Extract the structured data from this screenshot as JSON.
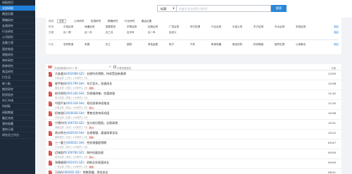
{
  "sidebar": {
    "items": [
      {
        "label": "研报首页"
      },
      {
        "label": "全部研报",
        "active": true
      },
      {
        "label": "晨会纪要"
      },
      {
        "label": "策略研究"
      },
      {
        "label": "宏观研究"
      },
      {
        "label": "行业研究"
      },
      {
        "label": "公司研究"
      },
      {
        "label": "金融工程"
      },
      {
        "label": "固定收益"
      },
      {
        "label": "港股研究"
      },
      {
        "label": "海外研究"
      },
      {
        "label": "债券研究"
      },
      {
        "label": "商品研究"
      },
      {
        "label": "衍生品"
      },
      {
        "label": "新三板"
      },
      {
        "label": "期货研究"
      },
      {
        "label": "投资组合"
      },
      {
        "label": "外汇市场"
      },
      {
        "label": "科创板"
      },
      {
        "label": "研报数据"
      },
      {
        "label": "最近浏览"
      },
      {
        "label": "我的收藏"
      },
      {
        "label": "我的订阅"
      },
      {
        "label": "研究员工作台"
      }
    ]
  },
  "search": {
    "type_label": "标题",
    "placeholder": "关键字/全文检索/分析师",
    "button_label": "搜索"
  },
  "filter": {
    "row1": {
      "label": "类别",
      "tags": [
        "全部",
        "公司研究",
        "宏观研究",
        "策略研究",
        "行业研究",
        "晨会纪要"
      ]
    },
    "row2": {
      "label": "机构",
      "tags": [
        "中信证券",
        "海通证券",
        "国泰君安",
        "华泰证券",
        "招商证券",
        "广发证券",
        "申万宏源",
        "兴业证券",
        "中金公司",
        "东方证券",
        "光大证券",
        "安信证券"
      ]
    },
    "row3": {
      "label": "日期",
      "tags": [
        "近一周",
        "近一月",
        "近三月",
        "近半年",
        "近一年",
        "自定义"
      ]
    },
    "row4": {
      "label": "行业",
      "tags": [
        "农林牧渔",
        "采掘",
        "化工",
        "钢铁",
        "有色金属",
        "电子",
        "汽车",
        "家用电器",
        "食品饮料",
        "纺织服装",
        "医药生物",
        "公用事业"
      ]
    },
    "toggle_label": "收起"
  },
  "list": {
    "header_text": "共找到研报5000+ 条",
    "header_check_label": "只看深度报告",
    "header_date_label": "日期",
    "rows": [
      {
        "company": "大族激光",
        "code": "(002008.SZ)",
        "title": "：业绩符合预期，持续受益新基建",
        "sub": "中泰证券  |  王芳  |  公司研究  |  3页",
        "tag": "",
        "time": "13:55"
      },
      {
        "company": "星宇股份",
        "code": "(601799.SH)",
        "title": "：车灯龙头，加速成长",
        "sub": "国金证券  |  张斌  |  公司研究  |  4页",
        "tag": "增持",
        "time": "12:08"
      },
      {
        "company": "新华保险",
        "code": "(601336.SH)",
        "title": "：负债端改善，估值修复",
        "sub": "申万宏源  |  李明  |  公司研究  |  5页",
        "tag": "",
        "time": "11:42"
      },
      {
        "company": "中国平安",
        "code": "(601318.SH)",
        "title": "：寿险改革持续推进",
        "sub": "华泰证券  |  陈晨  |  公司研究  |  6页",
        "tag": "买入",
        "time": "11:20"
      },
      {
        "company": "招商银行",
        "code": "(600036.SH)",
        "title": "：零售优势持续巩固",
        "sub": "中信证券  |  赵磊  |  公司研究  |  4页",
        "tag": "",
        "time": "10:58"
      },
      {
        "company": "宁德时代",
        "code": "(300750.SZ)",
        "title": "：龙头地位稳固，业绩高增",
        "sub": "海通证券  |  刘洋  |  公司研究  |  7页",
        "tag": "买入",
        "time": "10:31"
      },
      {
        "company": "贵州茅台",
        "code": "(600519.SH)",
        "title": "：业绩稳健，渠道改革深化",
        "sub": "国泰君安  |  孙伟  |  公司研究  |  5页",
        "tag": "增持",
        "time": "10:12"
      },
      {
        "company": "三一重工",
        "code": "(600031.SH)",
        "title": "：挖机销量超预期",
        "sub": "兴业证券  |  周杰  |  公司研究  |  3页",
        "tag": "",
        "time": "09:47"
      },
      {
        "company": "迈瑞医疗",
        "code": "(300760.SZ)",
        "title": "：海外拓展加速",
        "sub": "招商证券  |  吴昊  |  公司研究  |  4页",
        "tag": "买入",
        "time": "09:30"
      },
      {
        "company": "海康威视",
        "code": "(002415.SZ)",
        "title": "：创新业务高速成长",
        "sub": "广发证券  |  郑凯  |  公司研究  |  6页",
        "tag": "增持",
        "time": "09:05"
      },
      {
        "company": "万科A",
        "code": "(000002.SZ)",
        "title": "：销售稳健，财务安全",
        "sub": "东方证券  |  冯涛  |  公司研究  |  3页",
        "tag": "",
        "time": "08:41"
      }
    ]
  }
}
